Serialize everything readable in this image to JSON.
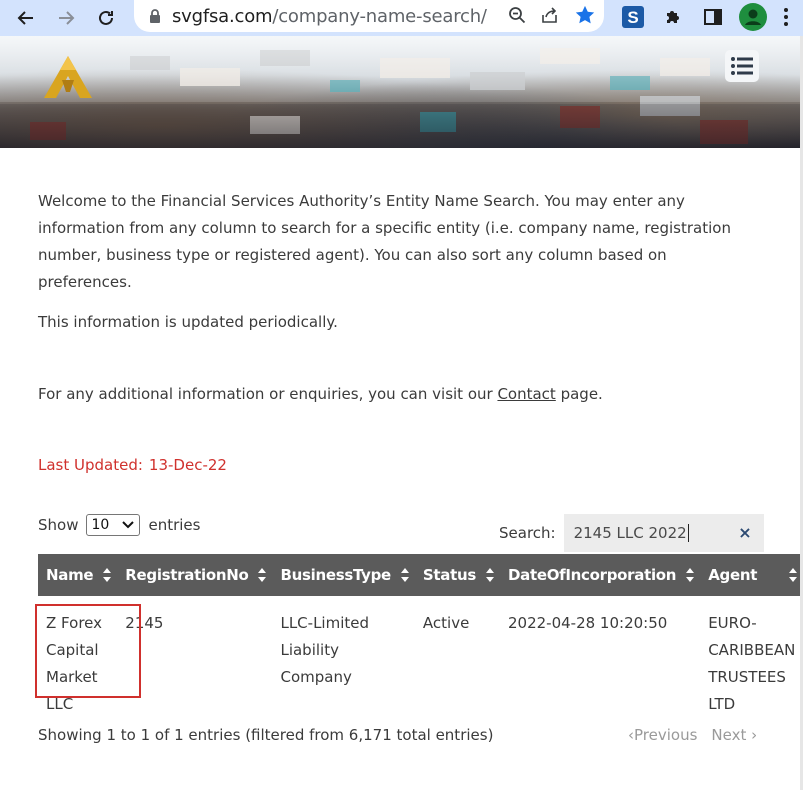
{
  "browser": {
    "url_host": "svgfsa.com",
    "url_path": "/company-name-search/"
  },
  "intro": {
    "paragraph1": "Welcome to the Financial Services Authority’s Entity Name Search. You may enter any information from any column to search for a specific entity (i.e. company name, registration number, business type or registered agent). You can also sort any column based on preferences.",
    "paragraph2": "This information is updated periodically.",
    "paragraph3_before": "For any additional information or enquiries, you can visit our ",
    "contact_link": "Contact",
    "paragraph3_after": " page.",
    "last_updated_label": "Last Updated:",
    "last_updated_date": "13-Dec-22"
  },
  "controls": {
    "show_label": "Show",
    "entries_value": "10",
    "entries_label": "entries",
    "search_label": "Search:",
    "search_value": "2145 LLC 2022",
    "clear_symbol": "×"
  },
  "table": {
    "columns": [
      "Name",
      "RegistrationNo",
      "BusinessType",
      "Status",
      "DateOfIncorporation",
      "Agent"
    ],
    "rows": [
      {
        "name": "Z Forex Capital Market LLC",
        "registration_no": "2145",
        "business_type": "LLC-Limited Liability Company",
        "status": "Active",
        "date": "2022-04-28 10:20:50",
        "agent": "EURO-CARIBBEAN TRUSTEES LTD"
      }
    ]
  },
  "footer": {
    "info": "Showing 1 to 1 of 1 entries (filtered from 6,171 total entries)",
    "previous": "Previous",
    "next": "Next"
  },
  "colors": {
    "chrome": "#d3e3fd",
    "header_bg": "#5b5b5b",
    "alert_red": "#d0312d",
    "highlight_box": "#d0302d"
  }
}
